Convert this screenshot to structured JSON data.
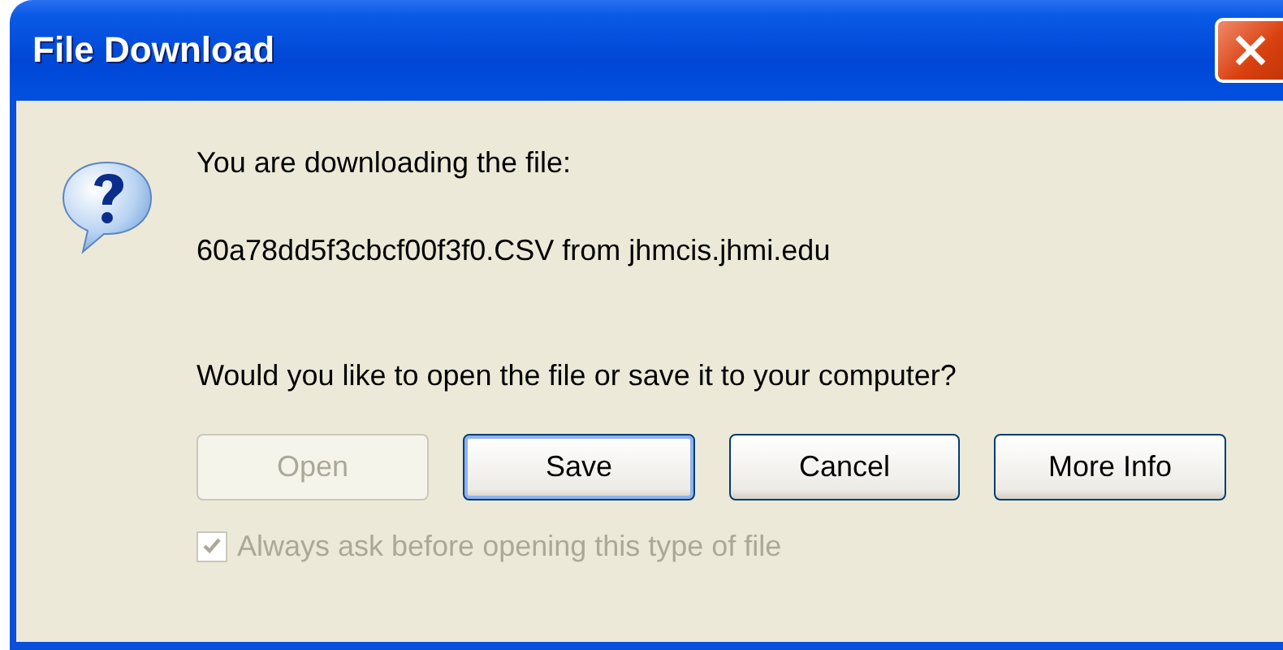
{
  "window": {
    "title": "File Download"
  },
  "message": {
    "intro": "You are downloading the file:",
    "file": "60a78dd5f3cbcf00f3f0.CSV from jhmcis.jhmi.edu",
    "question": "Would you like to open the file or save it to your computer?"
  },
  "buttons": [
    {
      "label": "Open",
      "disabled": true,
      "default": false
    },
    {
      "label": "Save",
      "disabled": false,
      "default": true
    },
    {
      "label": "Cancel",
      "disabled": false,
      "default": false
    },
    {
      "label": "More Info",
      "disabled": false,
      "default": false
    }
  ],
  "checkbox": {
    "label": "Always ask before opening this type of file",
    "checked": true,
    "disabled": true
  }
}
